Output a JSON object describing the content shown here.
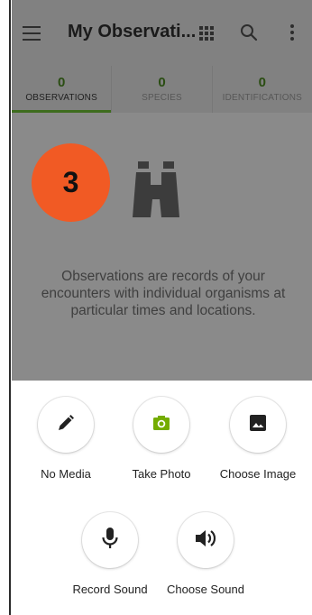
{
  "app_bar": {
    "title": "My Observati...",
    "icons": [
      "menu-icon",
      "grid-view-icon",
      "search-icon",
      "more-vert-icon"
    ]
  },
  "tabs": [
    {
      "count": "0",
      "label": "OBSERVATIONS",
      "active": true
    },
    {
      "count": "0",
      "label": "SPECIES",
      "active": false
    },
    {
      "count": "0",
      "label": "IDENTIFICATIONS",
      "active": false
    }
  ],
  "empty_state": {
    "badge": "3",
    "icon": "binoculars-icon",
    "message": "Observations are records of your encounters with individual organisms at particular times and locations."
  },
  "sheet": {
    "options": [
      {
        "label": "No Media",
        "icon": "pencil-icon"
      },
      {
        "label": "Take Photo",
        "icon": "camera-icon"
      },
      {
        "label": "Choose Image",
        "icon": "image-icon"
      },
      {
        "label": "Record Sound",
        "icon": "microphone-icon"
      },
      {
        "label": "Choose Sound",
        "icon": "speaker-icon"
      }
    ]
  },
  "colors": {
    "accent_green": "#74ac00",
    "badge_orange": "#f15a24",
    "scrim_gray": "#8a8a8a"
  }
}
